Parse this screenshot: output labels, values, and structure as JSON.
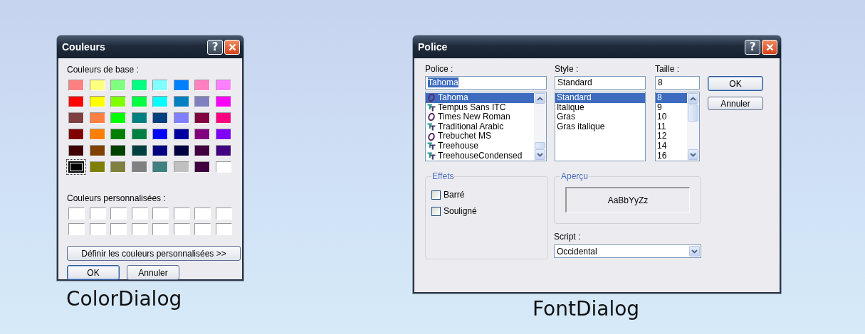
{
  "color_dialog": {
    "title": "Couleurs",
    "title_buttons": [
      {
        "kind": "help",
        "glyph": "?"
      },
      {
        "kind": "close"
      }
    ],
    "basic_label": "Couleurs de base :",
    "basic_colors": [
      {
        "color": "#ff8080",
        "selected": false
      },
      {
        "color": "#ffff80",
        "selected": false
      },
      {
        "color": "#80ff80",
        "selected": false
      },
      {
        "color": "#00ff80",
        "selected": false
      },
      {
        "color": "#80ffff",
        "selected": false
      },
      {
        "color": "#0080ff",
        "selected": false
      },
      {
        "color": "#ff80c0",
        "selected": false
      },
      {
        "color": "#ff80ff",
        "selected": false
      },
      {
        "color": "#ff0000",
        "selected": false
      },
      {
        "color": "#ffff00",
        "selected": false
      },
      {
        "color": "#80ff00",
        "selected": false
      },
      {
        "color": "#00ff40",
        "selected": false
      },
      {
        "color": "#00ffff",
        "selected": false
      },
      {
        "color": "#0080c0",
        "selected": false
      },
      {
        "color": "#8080c0",
        "selected": false
      },
      {
        "color": "#ff00ff",
        "selected": false
      },
      {
        "color": "#804040",
        "selected": false
      },
      {
        "color": "#ff8040",
        "selected": false
      },
      {
        "color": "#00ff00",
        "selected": false
      },
      {
        "color": "#008080",
        "selected": false
      },
      {
        "color": "#004080",
        "selected": false
      },
      {
        "color": "#8080ff",
        "selected": false
      },
      {
        "color": "#800040",
        "selected": false
      },
      {
        "color": "#ff0080",
        "selected": false
      },
      {
        "color": "#800000",
        "selected": false
      },
      {
        "color": "#ff8000",
        "selected": false
      },
      {
        "color": "#008000",
        "selected": false
      },
      {
        "color": "#008040",
        "selected": false
      },
      {
        "color": "#0000ff",
        "selected": false
      },
      {
        "color": "#0000a0",
        "selected": false
      },
      {
        "color": "#800080",
        "selected": false
      },
      {
        "color": "#8000ff",
        "selected": false
      },
      {
        "color": "#400000",
        "selected": false
      },
      {
        "color": "#804000",
        "selected": false
      },
      {
        "color": "#004000",
        "selected": false
      },
      {
        "color": "#004040",
        "selected": false
      },
      {
        "color": "#000080",
        "selected": false
      },
      {
        "color": "#000040",
        "selected": false
      },
      {
        "color": "#400040",
        "selected": false
      },
      {
        "color": "#400080",
        "selected": false
      },
      {
        "color": "#000000",
        "selected": true
      },
      {
        "color": "#808000",
        "selected": false
      },
      {
        "color": "#808040",
        "selected": false
      },
      {
        "color": "#808080",
        "selected": false
      },
      {
        "color": "#408080",
        "selected": false
      },
      {
        "color": "#c0c0c0",
        "selected": false
      },
      {
        "color": "#400040",
        "selected": false
      },
      {
        "color": "#ffffff",
        "selected": false
      }
    ],
    "custom_label": "Couleurs personnalisées :",
    "custom_colors": [
      {
        "color": "#ffffff"
      },
      {
        "color": "#ffffff"
      },
      {
        "color": "#ffffff"
      },
      {
        "color": "#ffffff"
      },
      {
        "color": "#ffffff"
      },
      {
        "color": "#ffffff"
      },
      {
        "color": "#ffffff"
      },
      {
        "color": "#ffffff"
      },
      {
        "color": "#ffffff"
      },
      {
        "color": "#ffffff"
      },
      {
        "color": "#ffffff"
      },
      {
        "color": "#ffffff"
      },
      {
        "color": "#ffffff"
      },
      {
        "color": "#ffffff"
      },
      {
        "color": "#ffffff"
      },
      {
        "color": "#ffffff"
      }
    ],
    "define_button": "Définir les couleurs personnalisées >>",
    "buttons": [
      {
        "label": "OK",
        "default": true
      },
      {
        "label": "Annuler",
        "default": false
      }
    ],
    "caption": "ColorDialog"
  },
  "font_dialog": {
    "title": "Police",
    "title_buttons": [
      {
        "kind": "help",
        "glyph": "?"
      },
      {
        "kind": "close"
      }
    ],
    "font": {
      "label": "Police :",
      "value": "Tahoma",
      "items": [
        {
          "name": "Tahoma",
          "kind": "opentype",
          "selected": true
        },
        {
          "name": "Tempus Sans ITC",
          "kind": "truetype",
          "selected": false
        },
        {
          "name": "Times New Roman",
          "kind": "opentype",
          "selected": false
        },
        {
          "name": "Traditional Arabic",
          "kind": "truetype",
          "selected": false
        },
        {
          "name": "Trebuchet MS",
          "kind": "opentype",
          "selected": false
        },
        {
          "name": "Treehouse",
          "kind": "truetype",
          "selected": false
        },
        {
          "name": "TreehouseCondensed",
          "kind": "truetype",
          "selected": false
        }
      ]
    },
    "style": {
      "label": "Style :",
      "value": "Standard",
      "items": [
        {
          "name": "Standard",
          "selected": true
        },
        {
          "name": "Italique",
          "selected": false
        },
        {
          "name": "Gras",
          "selected": false
        },
        {
          "name": "Gras italique",
          "selected": false
        }
      ]
    },
    "size": {
      "label": "Taille :",
      "value": "8",
      "items": [
        {
          "name": "8",
          "selected": true
        },
        {
          "name": "9",
          "selected": false
        },
        {
          "name": "10",
          "selected": false
        },
        {
          "name": "11",
          "selected": false
        },
        {
          "name": "12",
          "selected": false
        },
        {
          "name": "14",
          "selected": false
        },
        {
          "name": "16",
          "selected": false
        }
      ]
    },
    "buttons": [
      {
        "label": "OK",
        "default": true
      },
      {
        "label": "Annuler",
        "default": false
      }
    ],
    "effects": {
      "title": "Effets",
      "options": [
        {
          "label": "Barré",
          "checked": false
        },
        {
          "label": "Souligné",
          "checked": false
        }
      ]
    },
    "preview": {
      "title": "Aperçu",
      "sample": "AaBbYyZz"
    },
    "script": {
      "label": "Script :",
      "value": "Occidental"
    },
    "caption": "FontDialog"
  }
}
